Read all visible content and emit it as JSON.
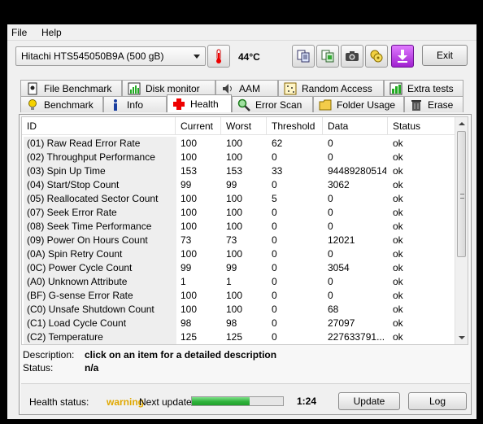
{
  "menu": {
    "file": "File",
    "help": "Help"
  },
  "toolbar": {
    "drive": "Hitachi HTS545050B9A (500 gB)",
    "temperature": "44°C",
    "exit_label": "Exit"
  },
  "tabs_top": [
    {
      "label": "File Benchmark",
      "icon": "file-benchmark-icon"
    },
    {
      "label": "Disk monitor",
      "icon": "disk-monitor-icon"
    },
    {
      "label": "AAM",
      "icon": "speaker-icon"
    },
    {
      "label": "Random Access",
      "icon": "random-access-icon"
    },
    {
      "label": "Extra tests",
      "icon": "extra-tests-icon"
    }
  ],
  "tabs_bottom": [
    {
      "label": "Benchmark",
      "icon": "lightbulb-icon"
    },
    {
      "label": "Info",
      "icon": "info-icon"
    },
    {
      "label": "Health",
      "icon": "red-cross-icon"
    },
    {
      "label": "Error Scan",
      "icon": "magnifier-icon"
    },
    {
      "label": "Folder Usage",
      "icon": "folder-icon"
    },
    {
      "label": "Erase",
      "icon": "trash-icon"
    }
  ],
  "active_tab": "Health",
  "table": {
    "headers": [
      "ID",
      "Current",
      "Worst",
      "Threshold",
      "Data",
      "Status"
    ],
    "rows": [
      [
        "(01) Raw Read Error Rate",
        "100",
        "100",
        "62",
        "0",
        "ok"
      ],
      [
        "(02) Throughput Performance",
        "100",
        "100",
        "0",
        "0",
        "ok"
      ],
      [
        "(03) Spin Up Time",
        "153",
        "153",
        "33",
        "94489280514",
        "ok"
      ],
      [
        "(04) Start/Stop Count",
        "99",
        "99",
        "0",
        "3062",
        "ok"
      ],
      [
        "(05) Reallocated Sector Count",
        "100",
        "100",
        "5",
        "0",
        "ok"
      ],
      [
        "(07) Seek Error Rate",
        "100",
        "100",
        "0",
        "0",
        "ok"
      ],
      [
        "(08) Seek Time Performance",
        "100",
        "100",
        "0",
        "0",
        "ok"
      ],
      [
        "(09) Power On Hours Count",
        "73",
        "73",
        "0",
        "12021",
        "ok"
      ],
      [
        "(0A) Spin Retry Count",
        "100",
        "100",
        "0",
        "0",
        "ok"
      ],
      [
        "(0C) Power Cycle Count",
        "99",
        "99",
        "0",
        "3054",
        "ok"
      ],
      [
        "(A0) Unknown Attribute",
        "1",
        "1",
        "0",
        "0",
        "ok"
      ],
      [
        "(BF) G-sense Error Rate",
        "100",
        "100",
        "0",
        "0",
        "ok"
      ],
      [
        "(C0) Unsafe Shutdown Count",
        "100",
        "100",
        "0",
        "68",
        "ok"
      ],
      [
        "(C1) Load Cycle Count",
        "98",
        "98",
        "0",
        "27097",
        "ok"
      ],
      [
        "(C2) Temperature",
        "125",
        "125",
        "0",
        "227633791...",
        "ok"
      ]
    ]
  },
  "details": {
    "description_label": "Description:",
    "description_value": "click on an item for a detailed description",
    "status_label": "Status:",
    "status_value": "n/a"
  },
  "footer": {
    "health_label": "Health status:",
    "health_value": "warning",
    "health_color": "#e0a800",
    "next_update_label": "Next update:",
    "progress": 0.63,
    "countdown": "1:24",
    "update_label": "Update",
    "log_label": "Log"
  }
}
